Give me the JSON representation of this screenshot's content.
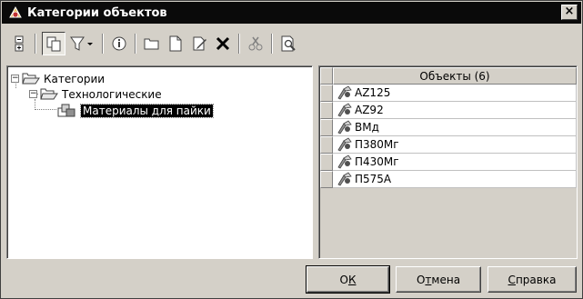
{
  "window": {
    "title": "Категории объектов",
    "close_label": "×"
  },
  "toolbar": {
    "buttons": [
      "expand-icon",
      "copy-icon",
      "filter-icon",
      "info-icon",
      "folder-icon",
      "new-document-icon",
      "edit-icon",
      "delete-icon",
      "cut-icon",
      "preview-icon"
    ]
  },
  "tree": {
    "root_label": "Категории",
    "child_label": "Технологические",
    "leaf_label": "Материалы для пайки",
    "expander_symbol": "−"
  },
  "grid": {
    "header": "Объекты (6)",
    "rows": [
      "AZ125",
      "AZ92",
      "ВМд",
      "П380Мг",
      "П430Мг",
      "П575А"
    ]
  },
  "buttons": {
    "ok_prefix": "О",
    "ok_underlined": "К",
    "cancel_prefix": "О",
    "cancel_underlined": "т",
    "cancel_rest": "мена",
    "help_underlined": "С",
    "help_rest": "правка"
  }
}
